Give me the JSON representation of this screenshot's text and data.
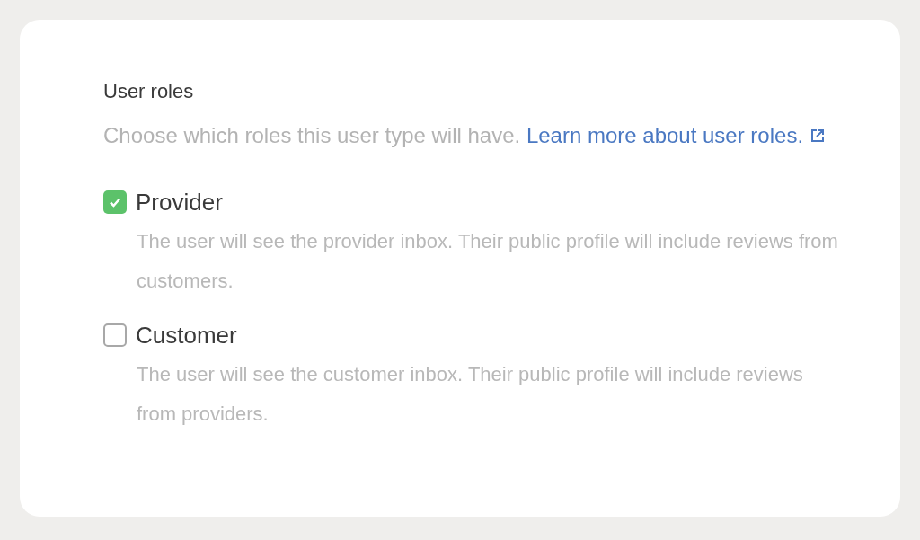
{
  "section": {
    "title": "User roles",
    "description": "Choose which roles this user type will have.",
    "link": "Learn more about user roles."
  },
  "roles": [
    {
      "label": "Provider",
      "checked": true,
      "description": "The user will see the provider inbox. Their public profile will include reviews from customers."
    },
    {
      "label": "Customer",
      "checked": false,
      "description": "The user will see the customer inbox. Their public profile will include reviews from providers."
    }
  ]
}
